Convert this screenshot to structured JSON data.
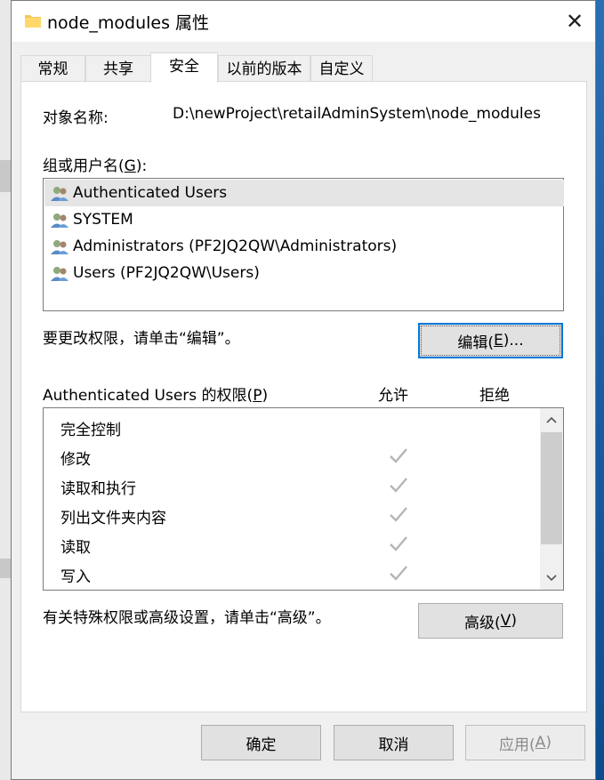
{
  "window": {
    "title": "node_modules 属性",
    "close_glyph": "✕"
  },
  "tabs": [
    {
      "label": "常规"
    },
    {
      "label": "共享"
    },
    {
      "label": "安全"
    },
    {
      "label": "以前的版本"
    },
    {
      "label": "自定义"
    }
  ],
  "object": {
    "label": "对象名称:",
    "value": "D:\\newProject\\retailAdminSystem\\node_modules"
  },
  "groups": {
    "label_text": "组或用户名(",
    "label_key": "G",
    "label_end": "):",
    "items": [
      {
        "name": "Authenticated Users",
        "selected": true
      },
      {
        "name": "SYSTEM",
        "selected": false
      },
      {
        "name": "Administrators (PF2JQ2QW\\Administrators)",
        "selected": false
      },
      {
        "name": "Users (PF2JQ2QW\\Users)",
        "selected": false
      }
    ]
  },
  "edit": {
    "hint": "要更改权限，请单击“编辑”。",
    "button_text": "编辑(",
    "button_key": "E",
    "button_end": ")..."
  },
  "permissions": {
    "label_text": "Authenticated Users 的权限(",
    "label_key": "P",
    "label_end": ")",
    "allow_header": "允许",
    "deny_header": "拒绝",
    "items": [
      {
        "name": "完全控制",
        "allow": false,
        "deny": false
      },
      {
        "name": "修改",
        "allow": true,
        "deny": false
      },
      {
        "name": "读取和执行",
        "allow": true,
        "deny": false
      },
      {
        "name": "列出文件夹内容",
        "allow": true,
        "deny": false
      },
      {
        "name": "读取",
        "allow": true,
        "deny": false
      },
      {
        "name": "写入",
        "allow": true,
        "deny": false
      }
    ]
  },
  "advanced": {
    "hint": "有关特殊权限或高级设置，请单击“高级”。",
    "button_text": "高级(",
    "button_key": "V",
    "button_end": ")"
  },
  "footer": {
    "ok": "确定",
    "cancel": "取消",
    "apply_text": "应用(",
    "apply_key": "A",
    "apply_end": ")"
  },
  "colors": {
    "accent": "#0078d7",
    "taskbar": "#1a5fa6",
    "check": "#b5b5b5"
  }
}
